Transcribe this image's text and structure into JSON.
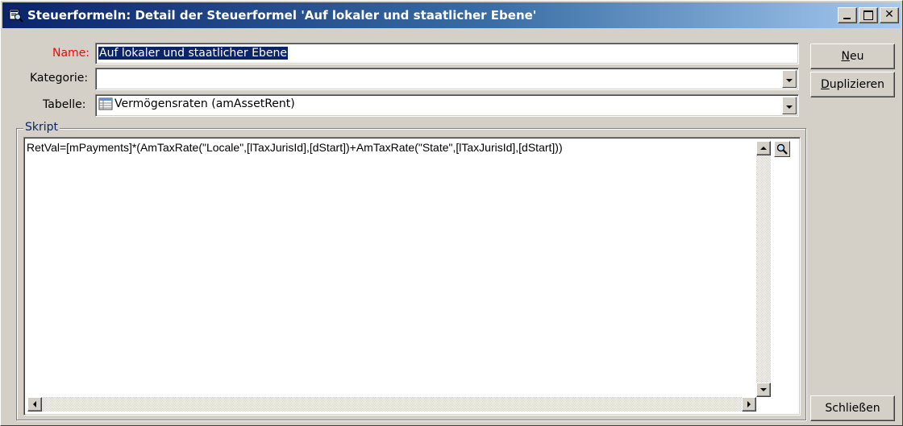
{
  "window": {
    "title": "Steuerformeln: Detail der Steuerformel 'Auf lokaler und staatlicher Ebene'"
  },
  "form": {
    "name_label": "Name:",
    "name_value": "Auf lokaler und staatlicher Ebene",
    "kategorie_label": "Kategorie:",
    "kategorie_value": "",
    "tabelle_label": "Tabelle:",
    "tabelle_value": "Vermögensraten (amAssetRent)"
  },
  "script": {
    "group_label": "Skript",
    "text": "RetVal=[mPayments]*(AmTaxRate(\"Locale\",[lTaxJurisId],[dStart])+AmTaxRate(\"State\",[lTaxJurisId],[dStart]))"
  },
  "buttons": {
    "neu_mnemonic": "N",
    "neu_rest": "eu",
    "duplizieren_mnemonic": "D",
    "duplizieren_rest": "uplizieren",
    "schliessen": "Schließen"
  },
  "colors": {
    "title_gradient_start": "#0a246a",
    "title_gradient_end": "#a6caf0",
    "name_label_color": "#ff0000",
    "selection_bg": "#0a246a",
    "group_label_color": "#0a246a",
    "face": "#d4d0c8"
  },
  "icons": {
    "title": "form-window-icon",
    "table": "table-icon",
    "zoom": "magnifier-icon"
  }
}
